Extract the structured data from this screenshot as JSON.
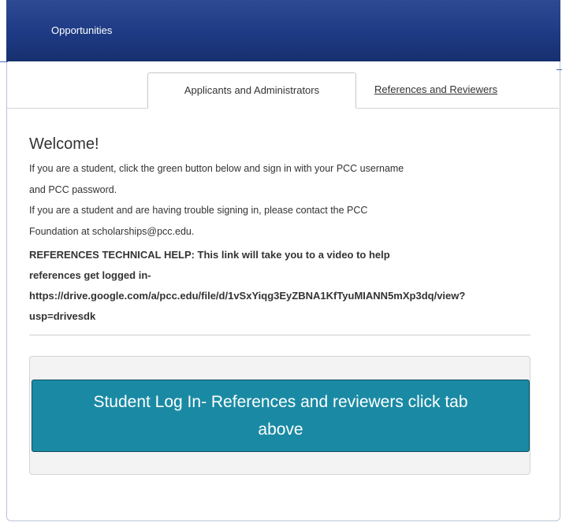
{
  "header": {
    "title": "Opportunities"
  },
  "tabs": [
    {
      "label": "Applicants and Administrators",
      "active": true
    },
    {
      "label": "References and Reviewers",
      "active": false
    }
  ],
  "content": {
    "heading": "Welcome!",
    "lines": [
      "If you are a student, click the green button below and sign in with your PCC username",
      "and PCC password.",
      "If you are a student and are having trouble signing in, please contact the PCC",
      "Foundation at scholarships@pcc.edu."
    ],
    "help_lines": [
      "REFERENCES TECHNICAL HELP: This link will take you to a video to help",
      "references get logged in-",
      "https://drive.google.com/a/pcc.edu/file/d/1vSxYiqg3EyZBNA1KfTyuMIANN5mXp3dq/view?",
      "usp=drivesdk"
    ]
  },
  "login_button": {
    "line1": "Student Log In- References and reviewers click tab",
    "line2": "above"
  },
  "colors": {
    "header_bg": "#1e3a84",
    "button_bg": "#1a8aa4"
  }
}
